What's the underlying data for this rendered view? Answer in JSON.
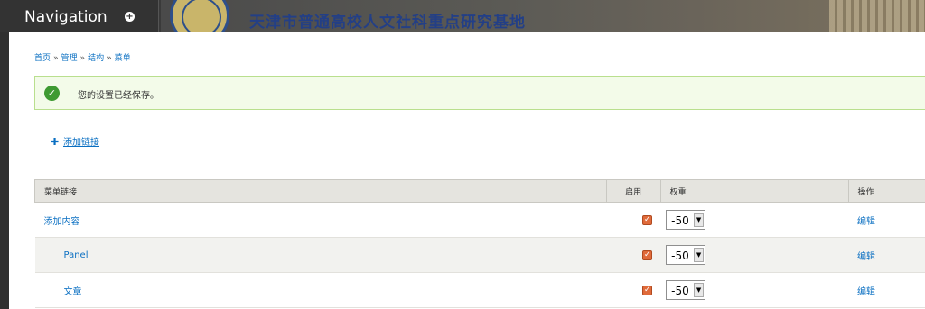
{
  "header": {
    "nav_title": "Navigation",
    "nav_toggle": "+",
    "site_title": "天津市普通高校人文社科重点研究基地"
  },
  "breadcrumb": {
    "items": [
      "首页",
      "管理",
      "结构",
      "菜单"
    ],
    "separator": "»"
  },
  "status": {
    "icon": "check-icon",
    "message": "您的设置已经保存。"
  },
  "add_link": {
    "icon": "plus-icon",
    "label": "添加链接"
  },
  "table": {
    "headers": {
      "title": "菜单链接",
      "enabled": "启用",
      "weight": "权重",
      "operations": "操作"
    },
    "rows": [
      {
        "title": "添加内容",
        "enabled": true,
        "weight": "-50",
        "operation": "编辑"
      },
      {
        "title": "Panel",
        "enabled": true,
        "weight": "-50",
        "operation": "编辑"
      },
      {
        "title": "文章",
        "enabled": true,
        "weight": "-50",
        "operation": "编辑"
      }
    ]
  },
  "colors": {
    "link": "#0a6fc2",
    "status_bg": "#f3fbe9",
    "status_border": "#b9df8e",
    "check_green": "#3e9a32",
    "checkbox": "#e06a3a"
  }
}
